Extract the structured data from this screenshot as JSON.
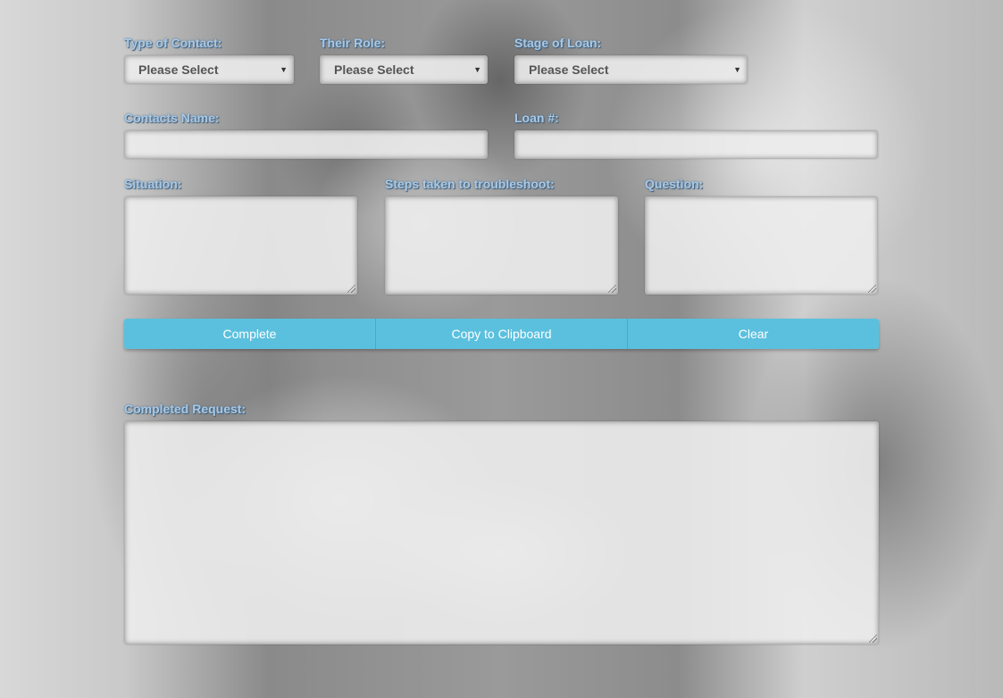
{
  "form": {
    "type_of_contact": {
      "label": "Type of Contact:",
      "value": "Please Select"
    },
    "their_role": {
      "label": "Their Role:",
      "value": "Please Select"
    },
    "stage_of_loan": {
      "label": "Stage of Loan:",
      "value": "Please Select"
    },
    "contacts_name": {
      "label": "Contacts Name:",
      "value": ""
    },
    "loan_number": {
      "label": "Loan #:",
      "value": ""
    },
    "situation": {
      "label": "Situation:",
      "value": ""
    },
    "steps_taken": {
      "label": "Steps taken to troubleshoot:",
      "value": ""
    },
    "question": {
      "label": "Question:",
      "value": ""
    },
    "completed_request": {
      "label": "Completed Request:",
      "value": ""
    }
  },
  "buttons": {
    "complete": "Complete",
    "copy": "Copy to Clipboard",
    "clear": "Clear"
  },
  "icons": {
    "select_arrow": "chevron-down-icon",
    "resize_grip": "resize-grip-icon"
  },
  "colors": {
    "button_bg": "#5bc0de",
    "label_text": "#a8c9e6"
  }
}
